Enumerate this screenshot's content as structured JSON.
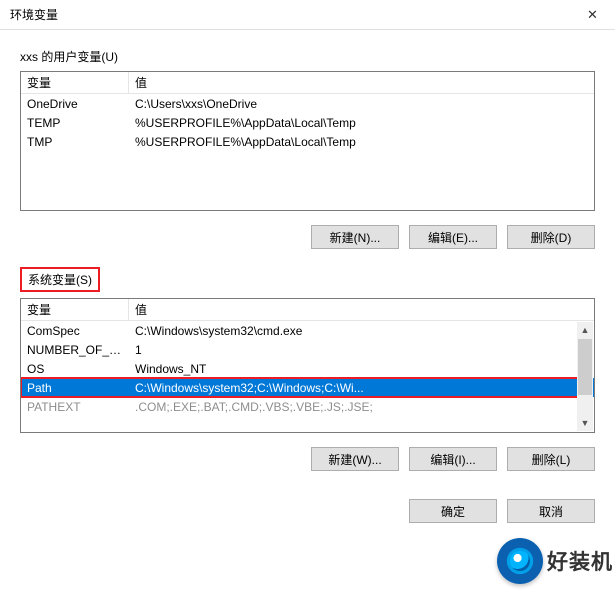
{
  "title": "环境变量",
  "user_section_label": "xxs 的用户变量(U)",
  "system_section_label": "系统变量(S)",
  "columns": {
    "name": "变量",
    "value": "值"
  },
  "user_vars": [
    {
      "name": "OneDrive",
      "value": "C:\\Users\\xxs\\OneDrive"
    },
    {
      "name": "TEMP",
      "value": "%USERPROFILE%\\AppData\\Local\\Temp"
    },
    {
      "name": "TMP",
      "value": "%USERPROFILE%\\AppData\\Local\\Temp"
    }
  ],
  "system_vars": [
    {
      "name": "ComSpec",
      "value": "C:\\Windows\\system32\\cmd.exe"
    },
    {
      "name": "NUMBER_OF_PR...",
      "value": "1"
    },
    {
      "name": "OS",
      "value": "Windows_NT"
    },
    {
      "name": "Path",
      "value": "C:\\Windows\\system32;C:\\Windows;C:\\Wi...",
      "selected": true,
      "highlight": true
    },
    {
      "name": "PATHEXT",
      "value": ".COM;.EXE;.BAT;.CMD;.VBS;.VBE;.JS;.JSE;"
    }
  ],
  "user_buttons": {
    "new": "新建(N)...",
    "edit": "编辑(E)...",
    "delete": "删除(D)"
  },
  "system_buttons": {
    "new": "新建(W)...",
    "edit": "编辑(I)...",
    "delete": "删除(L)"
  },
  "footer_buttons": {
    "ok": "确定",
    "cancel": "取消"
  },
  "watermark_text": "好装机"
}
